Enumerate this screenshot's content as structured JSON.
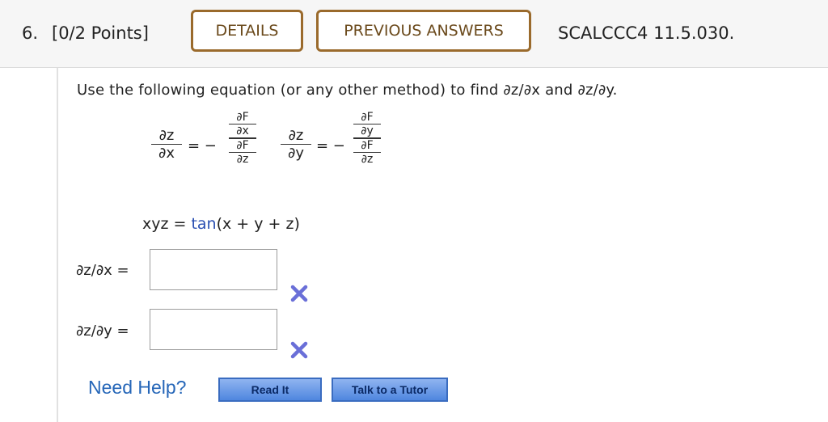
{
  "header": {
    "question_number": "6.",
    "points": "[0/2 Points]",
    "details_label": "DETAILS",
    "previous_answers_label": "PREVIOUS ANSWERS",
    "problem_code": "SCALCCC4 11.5.030."
  },
  "problem": {
    "instruction": "Use the following equation (or any other method) to find ∂z/∂x and ∂z/∂y.",
    "formula": {
      "dz": "∂z",
      "dx": "∂x",
      "dy": "∂y",
      "dF": "∂F",
      "equals_minus": "= −"
    },
    "equation_left": "xyz = ",
    "equation_fn": "tan",
    "equation_right": "(x + y + z)"
  },
  "answers": [
    {
      "label": "∂z/∂x =",
      "value": ""
    },
    {
      "label": "∂z/∂y =",
      "value": ""
    }
  ],
  "help": {
    "need_help": "Need Help?",
    "read_it": "Read It",
    "talk_to_tutor": "Talk to a Tutor"
  },
  "colors": {
    "outline_button_border": "#9a6a2c",
    "incorrect_mark": "#6a6fd8",
    "help_link": "#2566b8"
  }
}
